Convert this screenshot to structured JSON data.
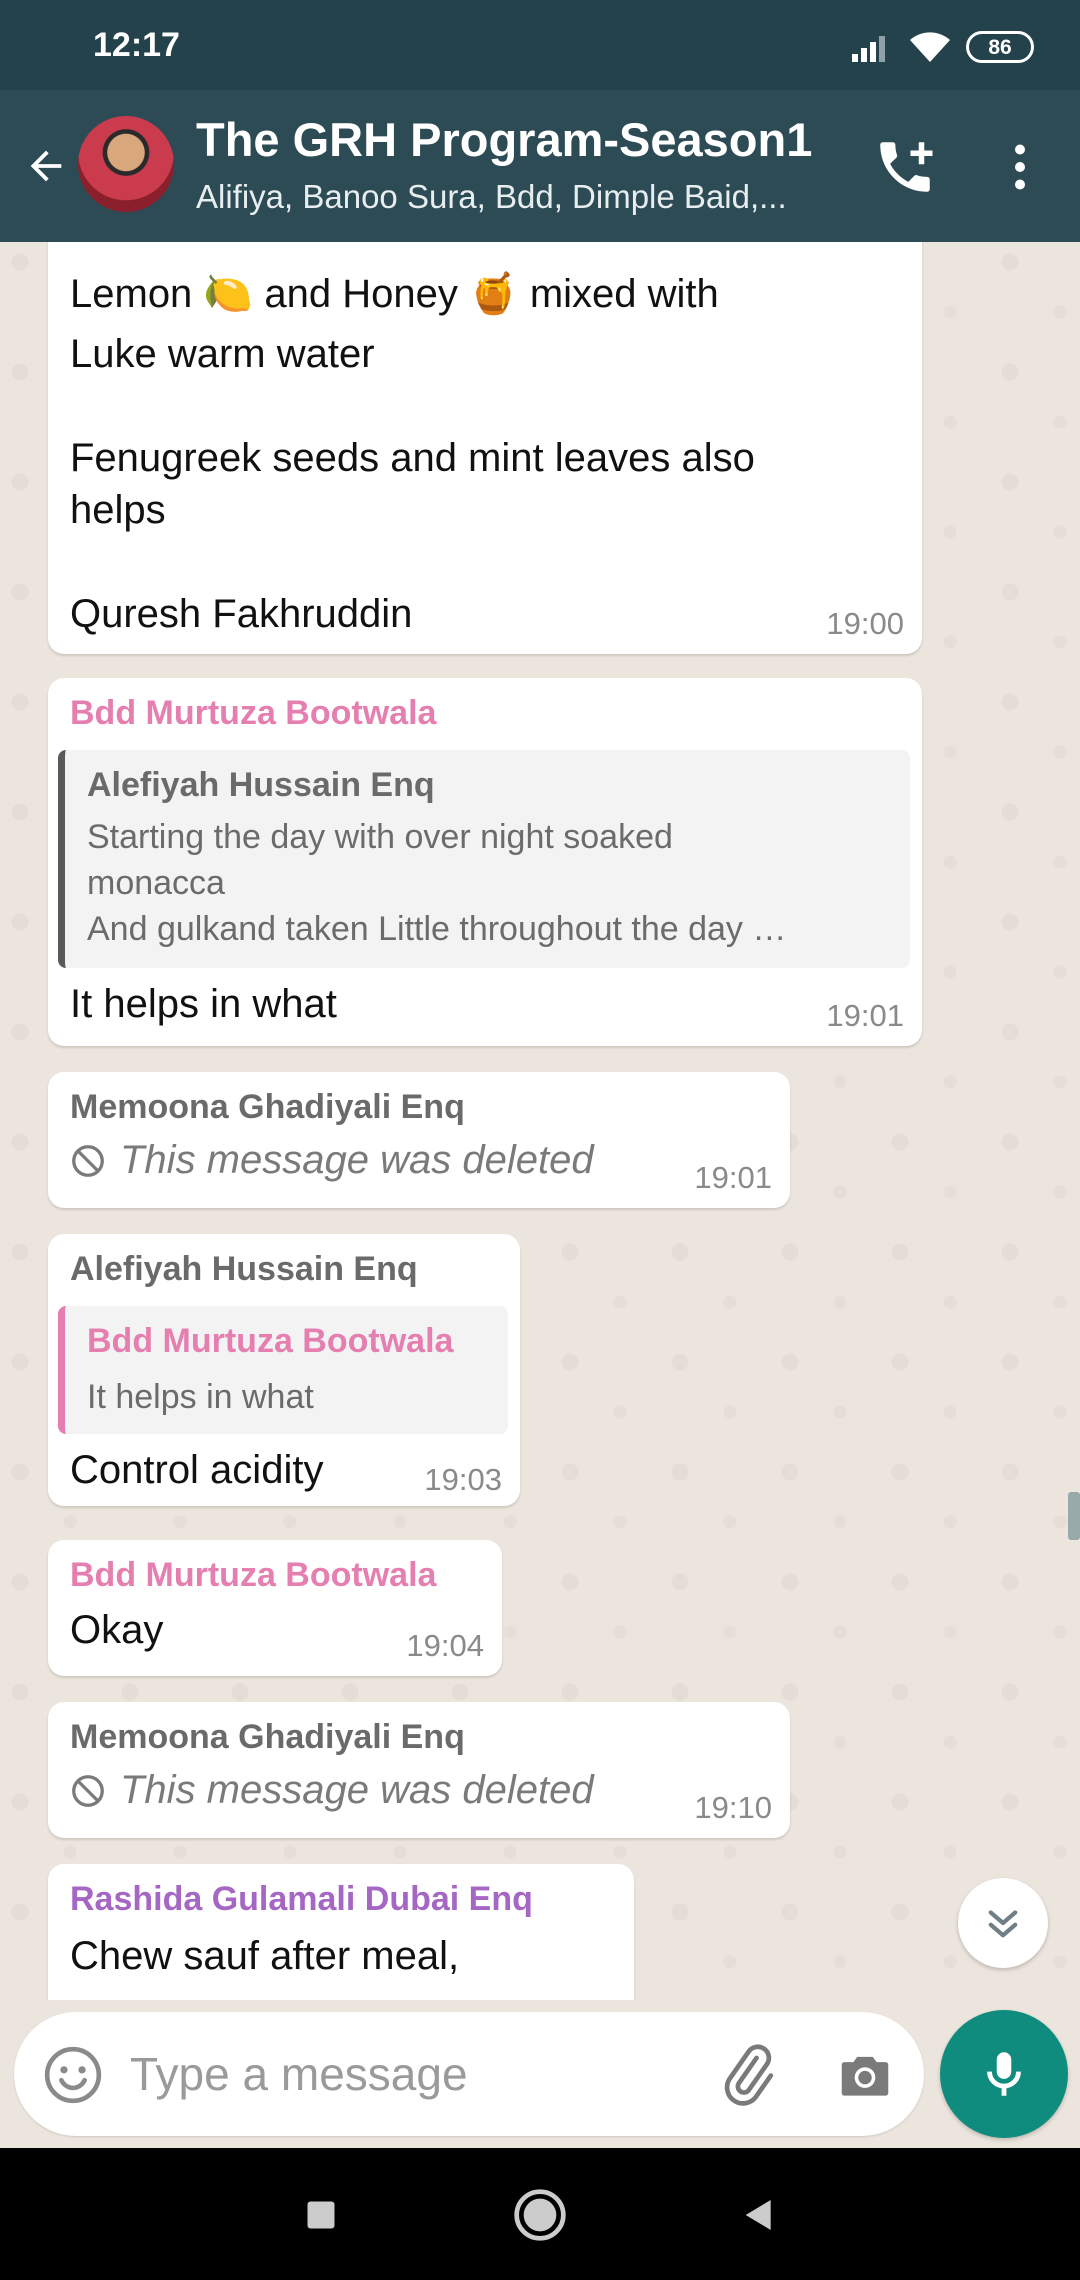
{
  "status_bar": {
    "time": "12:17",
    "battery": "86"
  },
  "header": {
    "title": "The GRH Program-Season1",
    "members": "Alifiya, Banoo Sura, Bdd, Dimple Baid,..."
  },
  "colors": {
    "header_bg": "#2D4B55",
    "status_bg": "#23424B",
    "chat_bg": "#ECE5DD",
    "accent_green": "#0F8C7D",
    "sender_pink": "#E57FB0",
    "sender_gray": "#6A6A6A",
    "sender_purple": "#A667C4"
  },
  "messages": [
    {
      "lines": [
        "Lemon 🍋 and Honey 🍯 mixed with",
        "Luke warm water",
        "Fenugreek seeds and mint leaves also",
        "helps",
        "Quresh Fakhruddin"
      ],
      "time": "19:00"
    },
    {
      "sender": "Bdd Murtuza Bootwala",
      "quote": {
        "sender": "Alefiyah Hussain Enq",
        "lines": [
          "Starting the day with over night soaked",
          "monacca",
          "And gulkand taken Little throughout the day …"
        ]
      },
      "text": "It helps in what",
      "time": "19:01"
    },
    {
      "sender": "Memoona Ghadiyali Enq",
      "deleted_text": "This message was deleted",
      "time": "19:01"
    },
    {
      "sender": "Alefiyah Hussain Enq",
      "quote": {
        "sender": "Bdd Murtuza Bootwala",
        "text": "It helps in what"
      },
      "text": "Control acidity",
      "time": "19:03"
    },
    {
      "sender": "Bdd Murtuza Bootwala",
      "text": "Okay",
      "time": "19:04"
    },
    {
      "sender": "Memoona Ghadiyali Enq",
      "deleted_text": "This message was deleted",
      "time": "19:10"
    },
    {
      "sender": "Rashida Gulamali Dubai Enq",
      "text": "Chew sauf after meal,"
    }
  ],
  "input": {
    "placeholder": "Type a message"
  },
  "icons": {
    "back": "arrow-left-icon",
    "call": "add-call-icon",
    "menu": "more-vert-icon",
    "emoji": "emoji-icon",
    "attach": "paperclip-icon",
    "camera": "camera-icon",
    "mic": "microphone-icon",
    "scroll_down": "double-chevron-down-icon",
    "deleted": "ban-icon"
  }
}
